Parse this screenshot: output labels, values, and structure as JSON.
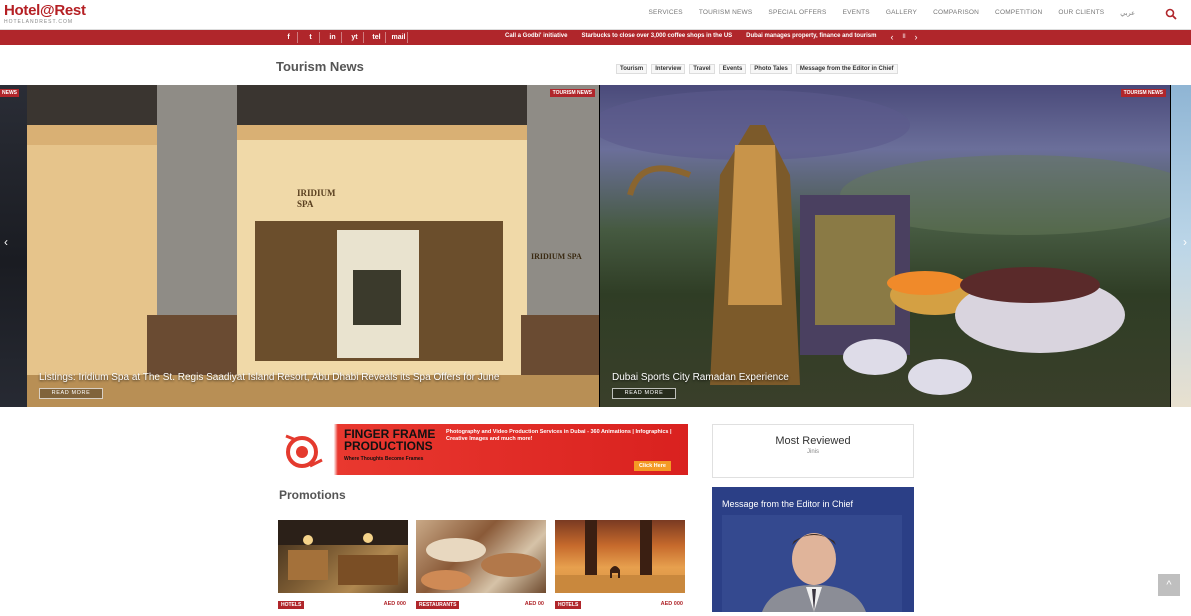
{
  "brand": {
    "name": "Hotel@Rest",
    "tagline": "HOTELANDREST.COM"
  },
  "nav": {
    "items": [
      "SERVICES",
      "TOURISM NEWS",
      "SPECIAL OFFERS",
      "EVENTS",
      "GALLERY",
      "COMPARISON",
      "COMPETITION",
      "OUR CLIENTS",
      "عربي"
    ]
  },
  "social": [
    "f",
    "t",
    "in",
    "yt",
    "tel",
    "mail"
  ],
  "ticker": {
    "items": [
      "Call a Godbi' initiative",
      "Starbucks to close over 3,000 coffee shops in the US",
      "Dubai manages property, finance and tourism"
    ],
    "prev": "‹",
    "pause": "II",
    "next": "›"
  },
  "section": {
    "title": "Tourism News",
    "categories": [
      "Tourism",
      "Interview",
      "Travel",
      "Events",
      "Photo Tales",
      "Message from the Editor in Chief"
    ]
  },
  "slider": {
    "left_tag": "NEWS",
    "slides": [
      {
        "tag": "TOURISM NEWS",
        "caption": "Listings: Iridium Spa at The St. Regis Saadiyat Island Resort, Abu Dhabi Reveals its Spa Offers for June",
        "cta": "READ MORE",
        "sign_1": "IRIDIUM SPA",
        "sign_2": "IRIDIUM SPA"
      },
      {
        "tag": "TOURISM NEWS",
        "caption": "Dubai Sports City Ramadan Experience",
        "cta": "READ MORE"
      }
    ],
    "prev": "‹",
    "next": "›"
  },
  "ad": {
    "title": "FINGER FRAME\nPRODUCTIONS",
    "subtitle": "Where Thoughts Become Frames",
    "description": "Photography and Video Production Services in Dubai - 360 Animations | Infographics | Creative Images and much more!",
    "cta": "Click Here"
  },
  "promotions": {
    "title": "Promotions",
    "items": [
      {
        "tag": "HOTELS",
        "price": "AED 000"
      },
      {
        "tag": "RESTAURANTS",
        "price": "AED 00"
      },
      {
        "tag": "HOTELS",
        "price": "AED 000"
      }
    ]
  },
  "sidebar": {
    "most_reviewed": {
      "title": "Most Reviewed",
      "subtitle": "Jinis"
    },
    "editor": {
      "title": "Message from the Editor in Chief"
    }
  },
  "back_to_top": "^",
  "colors": {
    "brand_red": "#b0262b",
    "editor_blue": "#2b3f86"
  }
}
